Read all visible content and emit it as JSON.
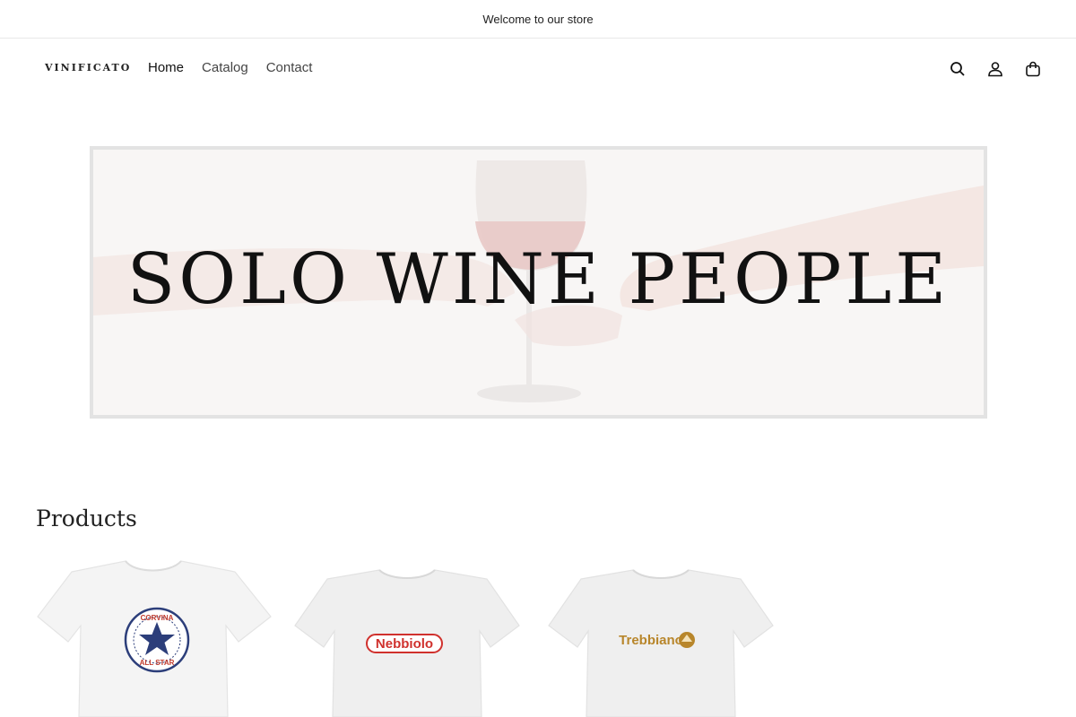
{
  "announcement": {
    "text": "Welcome to our store"
  },
  "header": {
    "logo": "VINIFICATO",
    "nav": [
      {
        "label": "Home",
        "active": true
      },
      {
        "label": "Catalog",
        "active": false
      },
      {
        "label": "Contact",
        "active": false
      }
    ],
    "icons": [
      "search-icon",
      "account-icon",
      "cart-icon"
    ]
  },
  "hero": {
    "title": "SOLO WINE PEOPLE"
  },
  "products": {
    "heading": "Products",
    "items": [
      {
        "graphic_text": "CORVINA ALL STAR",
        "graphic_color": "#2c3e7a",
        "accent": "#c0392b"
      },
      {
        "graphic_text": "Nebbiolo",
        "graphic_color": "#d0312d"
      },
      {
        "graphic_text": "Trebbiano",
        "graphic_color": "#b8862b"
      }
    ]
  }
}
